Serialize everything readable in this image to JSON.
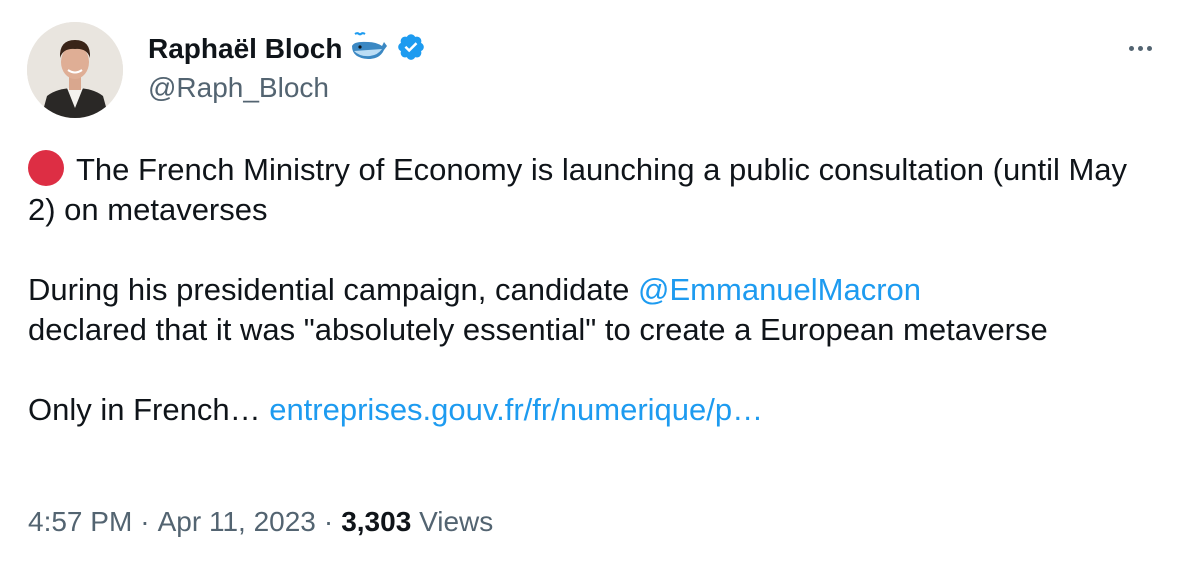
{
  "author": {
    "name": "Raphaël Bloch",
    "handle": "@Raph_Bloch",
    "emoji_icon": "whale-icon",
    "verified_icon": "verified-badge-icon"
  },
  "more_icon": "more-options-icon",
  "tweet": {
    "line1_prefix_icon": "red-circle-icon",
    "paragraph1": "The French Ministry of Economy is launching a public consultation (until May 2) on metaverses",
    "paragraph2_before": "During his presidential campaign, candidate ",
    "paragraph2_mention": "@EmmanuelMacron",
    "paragraph2_after": "declared that it was \"absolutely essential\" to create a European metaverse",
    "paragraph3_before": "Only in French… ",
    "paragraph3_link": "entreprises.gouv.fr/fr/numerique/p…"
  },
  "meta": {
    "time": "4:57 PM",
    "separator": "·",
    "date": "Apr 11, 2023",
    "views_count": "3,303",
    "views_label": "Views"
  },
  "colors": {
    "link": "#1d9bf0",
    "secondary_text": "#536471",
    "primary_text": "#0f1419",
    "red_circle": "#dd2e44"
  }
}
